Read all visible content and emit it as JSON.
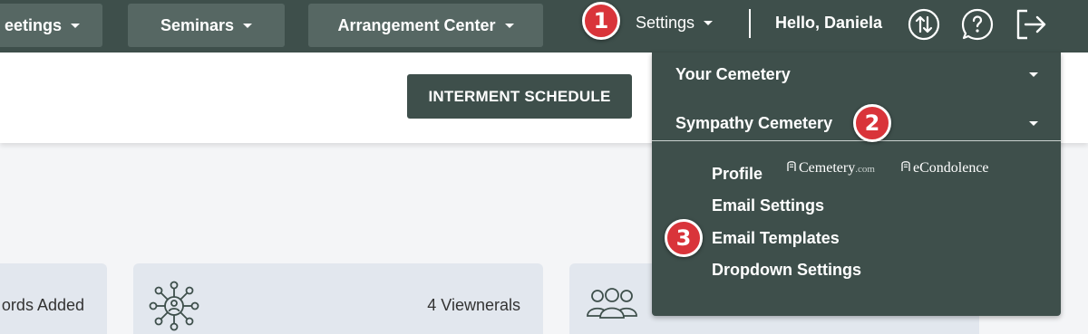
{
  "nav": {
    "meetings_label": "eetings",
    "seminars_label": "Seminars",
    "arrangement_label": "Arrangement Center",
    "settings_label": "Settings",
    "greeting": "Hello, Daniela",
    "icons": [
      "sort-arrows-icon",
      "help-icon",
      "logout-icon"
    ]
  },
  "header": {
    "interment_label": "INTERMENT SCHEDULE"
  },
  "dropdown": {
    "sections": [
      {
        "label": "Your Cemetery"
      },
      {
        "label": "Sympathy Cemetery"
      }
    ],
    "items": [
      {
        "label": "Profile"
      },
      {
        "label": "Email Settings"
      },
      {
        "label": "Email Templates"
      },
      {
        "label": "Dropdown Settings"
      }
    ],
    "brands": {
      "cemetery": "Cemetery",
      "cemetery_suffix": ".com",
      "econdolence": "eCondolence"
    }
  },
  "cards": [
    {
      "text": "ords Added"
    },
    {
      "text": "4 Viewnerals",
      "icon": "network-people-icon"
    },
    {
      "text": "",
      "icon": "group-people-icon"
    }
  ],
  "callouts": [
    "1",
    "2",
    "3"
  ],
  "colors": {
    "nav_bg": "#3e4f4b",
    "nav_button": "#566763",
    "callout": "#d9343a",
    "card_bg": "#e2e7ee"
  }
}
